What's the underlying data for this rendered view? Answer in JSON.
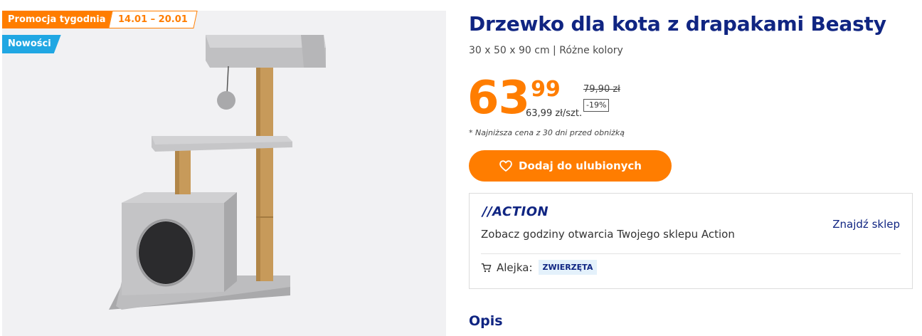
{
  "badges": {
    "promo": "Promocja tygodnia",
    "dates": "14.01 – 20.01",
    "new": "Nowości"
  },
  "product": {
    "title": "Drzewko dla kota z drapakami Beasty",
    "subtitle": "30 x 50 x 90 cm | Różne kolory"
  },
  "price": {
    "integer": "63",
    "decimal": "99",
    "unit_price": "63,99 zł/szt.",
    "old_price": "79,90 zł",
    "discount": "-19%",
    "note": "* Najniższa cena z 30 dni przed obniżką"
  },
  "favorites_button": {
    "label": "Dodaj do ulubionych"
  },
  "store": {
    "logo": "//ACTION",
    "hours_text": "Zobacz godziny otwarcia Twojego sklepu Action",
    "find_store": "Znajdź sklep",
    "aisle_label": "Alejka:",
    "aisle_value": "ZWIERZĘTA"
  },
  "description": {
    "heading": "Opis"
  },
  "colors": {
    "accent_orange": "#ff7d00",
    "brand_navy": "#102582",
    "new_badge_blue": "#20a7e3"
  },
  "icons": {
    "favorite": "heart-icon",
    "aisle": "cart-icon"
  }
}
